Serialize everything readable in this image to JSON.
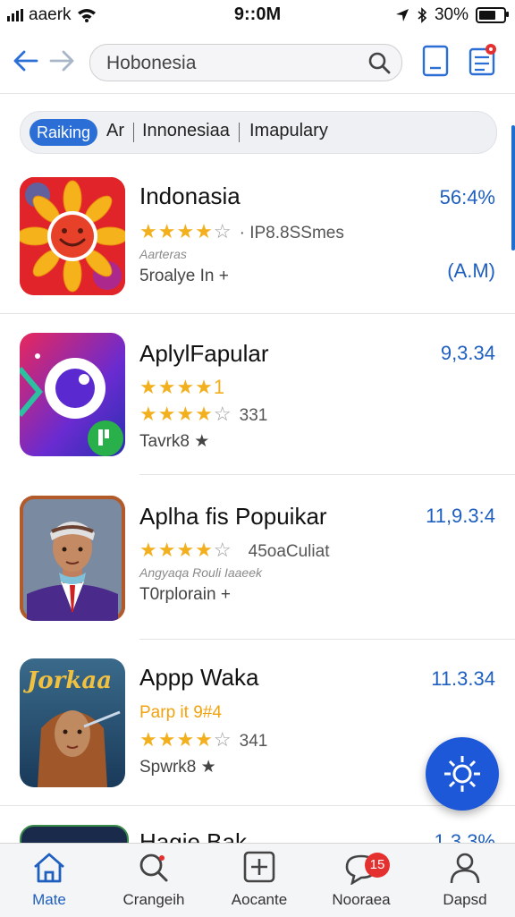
{
  "status_bar": {
    "carrier": "aaerk",
    "time": "9::0M",
    "battery": "30%"
  },
  "search": {
    "query": "Hobonesia"
  },
  "chips": {
    "active": "Raiking",
    "items": [
      "Ar",
      "Innonesiaa",
      "Imapulary"
    ]
  },
  "apps": [
    {
      "title": "Indonasia",
      "price": "56:4%",
      "stars": "★★★★",
      "empty": "☆",
      "meta": "· IP8.8SSmes",
      "small": "Aarteras",
      "sub": "5roalye In +",
      "side": "(A.M)"
    },
    {
      "title": "AplylFapular",
      "price": "9,3.34",
      "stars_top": "★★★★1",
      "stars": "★★★★",
      "empty": "☆",
      "meta": "331",
      "sub": "Tavrk8 ★"
    },
    {
      "title": "Aplha fis Popuikar",
      "price": "11,9.3:4",
      "stars": "★★★★",
      "empty": "☆",
      "meta": "45oaCuliat",
      "small": "Angyaqa Rouli Iaaeek",
      "sub": "T0rplorain +"
    },
    {
      "title": "Appp Waka",
      "price": "11.3.34",
      "highlight": "Parp it 9#4",
      "stars": "★★★★",
      "empty": "☆",
      "meta": "341",
      "sub": "Spwrk8 ★"
    },
    {
      "title": "Hagie Bak",
      "price": "1.3.3%"
    }
  ],
  "icon_text": {
    "jorkaa": "Jorkaa"
  },
  "tabs": [
    {
      "label": "Mate",
      "icon": "home-icon"
    },
    {
      "label": "Crangeih",
      "icon": "search-icon"
    },
    {
      "label": "Aocante",
      "icon": "add-icon"
    },
    {
      "label": "Nooraea",
      "icon": "chat-icon",
      "badge": "15"
    },
    {
      "label": "Dapsd",
      "icon": "profile-icon"
    }
  ],
  "colors": {
    "accent": "#1f5fbf",
    "star": "#f2b01e",
    "fab": "#1d58d8"
  }
}
